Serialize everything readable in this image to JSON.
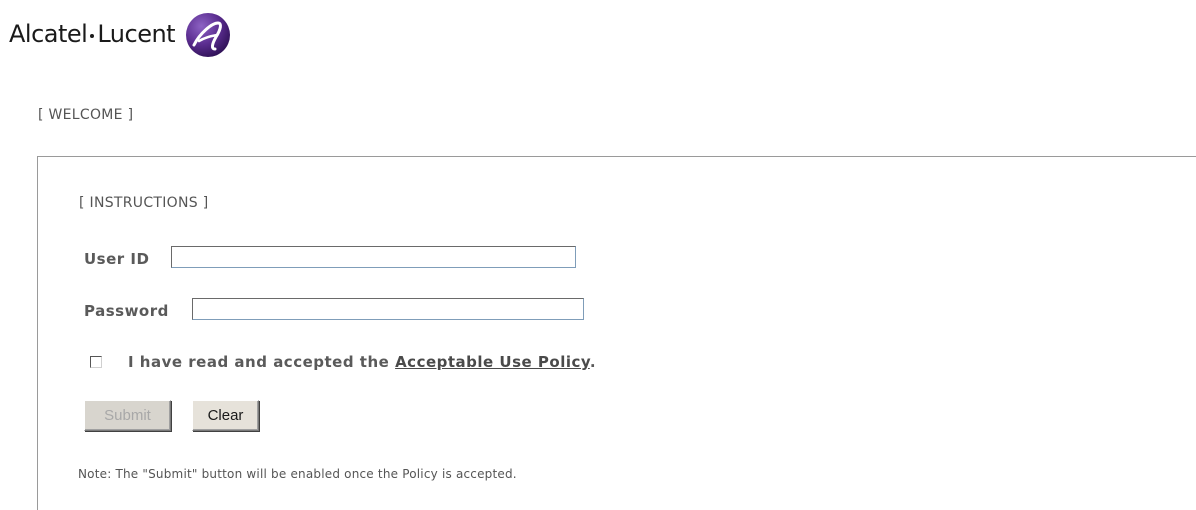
{
  "brand": {
    "name_part1": "Alcatel",
    "name_part2": "Lucent",
    "logo_icon": "alcatel-lucent-a-logo",
    "accent_color": "#5b2d90"
  },
  "header": {
    "welcome": "[ WELCOME ]"
  },
  "form": {
    "instructions": "[ INSTRUCTIONS ]",
    "userid_label": "User ID",
    "userid_value": "",
    "password_label": "Password",
    "password_value": "",
    "policy_checked": false,
    "policy_prefix": "I have read and accepted the ",
    "policy_link": "Acceptable Use Policy",
    "policy_suffix": ".",
    "submit_label": "Submit",
    "submit_enabled": false,
    "clear_label": "Clear",
    "note": "Note: The \"Submit\" button will be enabled once the Policy is accepted."
  }
}
